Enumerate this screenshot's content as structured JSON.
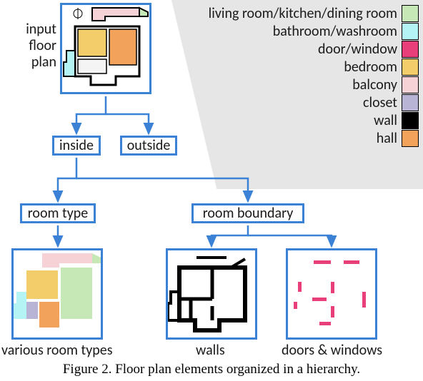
{
  "labels": {
    "input_floor_plan": "input\nfloor\nplan",
    "inside": "inside",
    "outside": "outside",
    "room_type": "room type",
    "room_boundary": "room boundary",
    "various_room_types": "various room types",
    "walls": "walls",
    "doors_windows": "doors & windows"
  },
  "legend": [
    {
      "label": "living room/kitchen/dining room",
      "color": "#c5e8b6"
    },
    {
      "label": "bathroom/washroom",
      "color": "#b5f4f4"
    },
    {
      "label": "door/window",
      "color": "#e83e7a"
    },
    {
      "label": "bedroom",
      "color": "#f4cd6b"
    },
    {
      "label": "balcony",
      "color": "#f6d2d7"
    },
    {
      "label": "closet",
      "color": "#b8b4d5"
    },
    {
      "label": "wall",
      "color": "#000000"
    },
    {
      "label": "hall",
      "color": "#f2a25a"
    }
  ],
  "caption": "Figure 2. Floor plan elements organized in a hierarchy."
}
